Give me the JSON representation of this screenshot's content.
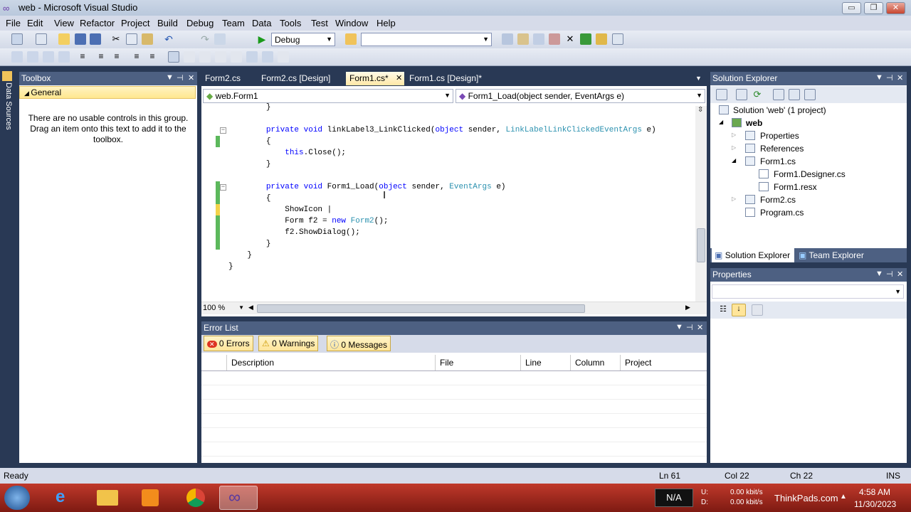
{
  "window": {
    "title": "web - Microsoft Visual Studio",
    "min": "▭",
    "max": "❐",
    "close": "✕"
  },
  "menu": [
    "File",
    "Edit",
    "View",
    "Refactor",
    "Project",
    "Build",
    "Debug",
    "Team",
    "Data",
    "Tools",
    "Test",
    "Window",
    "Help"
  ],
  "toolbar": {
    "config": "Debug",
    "platform": ""
  },
  "left_strip": {
    "label": "Data Sources"
  },
  "toolbox": {
    "title": "Toolbox",
    "group": "General",
    "empty_text": "There are no usable controls in this group. Drag an item onto this text to add it to the toolbox."
  },
  "tabs": [
    {
      "label": "Form2.cs"
    },
    {
      "label": "Form2.cs [Design]"
    },
    {
      "label": "Form1.cs*"
    },
    {
      "label": "Form1.cs [Design]*"
    }
  ],
  "editor": {
    "class_nav": "web.Form1",
    "member_nav": "Form1_Load(object sender, EventArgs e)",
    "zoom": "100 %",
    "lines": [
      {
        "indent": "        ",
        "parts": [
          [
            "",
            "}"
          ]
        ]
      },
      {
        "indent": "",
        "parts": []
      },
      {
        "indent": "        ",
        "parts": [
          [
            "kw",
            "private "
          ],
          [
            "kw",
            "void "
          ],
          [
            "",
            "linkLabel3_LinkClicked("
          ],
          [
            "kw",
            "object "
          ],
          [
            "",
            "sender, "
          ],
          [
            "ty",
            "LinkLabelLinkClickedEventArgs "
          ],
          [
            "",
            "e)"
          ]
        ]
      },
      {
        "indent": "        ",
        "parts": [
          [
            "",
            "{"
          ]
        ]
      },
      {
        "indent": "            ",
        "parts": [
          [
            "kw",
            "this"
          ],
          [
            "",
            ".Close();"
          ]
        ]
      },
      {
        "indent": "        ",
        "parts": [
          [
            "",
            "}"
          ]
        ]
      },
      {
        "indent": "",
        "parts": []
      },
      {
        "indent": "        ",
        "parts": [
          [
            "kw",
            "private "
          ],
          [
            "kw",
            "void "
          ],
          [
            "",
            "Form1_Load("
          ],
          [
            "kw",
            "object "
          ],
          [
            "",
            "sender, "
          ],
          [
            "ty",
            "EventArgs "
          ],
          [
            "",
            "e)"
          ]
        ]
      },
      {
        "indent": "        ",
        "parts": [
          [
            "",
            "{"
          ]
        ]
      },
      {
        "indent": "            ",
        "parts": [
          [
            "",
            "ShowIcon |"
          ]
        ]
      },
      {
        "indent": "            ",
        "parts": [
          [
            "",
            "Form f2 = "
          ],
          [
            "kw",
            "new "
          ],
          [
            "ty",
            "Form2"
          ],
          [
            "",
            "();"
          ]
        ]
      },
      {
        "indent": "            ",
        "parts": [
          [
            "",
            "f2.ShowDialog();"
          ]
        ]
      },
      {
        "indent": "        ",
        "parts": [
          [
            "",
            "}"
          ]
        ]
      },
      {
        "indent": "    ",
        "parts": [
          [
            "",
            "}"
          ]
        ]
      },
      {
        "indent": "",
        "parts": [
          [
            "",
            "}"
          ]
        ]
      }
    ]
  },
  "error_list": {
    "title": "Error List",
    "errors": "0 Errors",
    "warnings": "0 Warnings",
    "messages": "0 Messages",
    "columns": [
      "Description",
      "File",
      "Line",
      "Column",
      "Project"
    ]
  },
  "solution_explorer": {
    "title": "Solution Explorer",
    "tree": [
      "Solution 'web' (1 project)",
      "web",
      "Properties",
      "References",
      "Form1.cs",
      "Form1.Designer.cs",
      "Form1.resx",
      "Form2.cs",
      "Program.cs"
    ],
    "tab_solution": "Solution Explorer",
    "tab_team": "Team Explorer"
  },
  "properties": {
    "title": "Properties"
  },
  "status": {
    "state": "Ready",
    "ln": "Ln 61",
    "col": "Col 22",
    "ch": "Ch 22",
    "mode": "INS"
  },
  "taskbar": {
    "na": "N/A",
    "u_label": "U:",
    "d_label": "D:",
    "u_rate": "0.00 kbit/s",
    "d_rate": "0.00 kbit/s",
    "brand": "ThinkPads.com",
    "time": "4:58 AM",
    "date": "11/30/2023"
  },
  "colors": {
    "accent": "#293955",
    "tab_active": "#ffe8a6",
    "keyword": "#0000ff",
    "type": "#2b91af"
  }
}
